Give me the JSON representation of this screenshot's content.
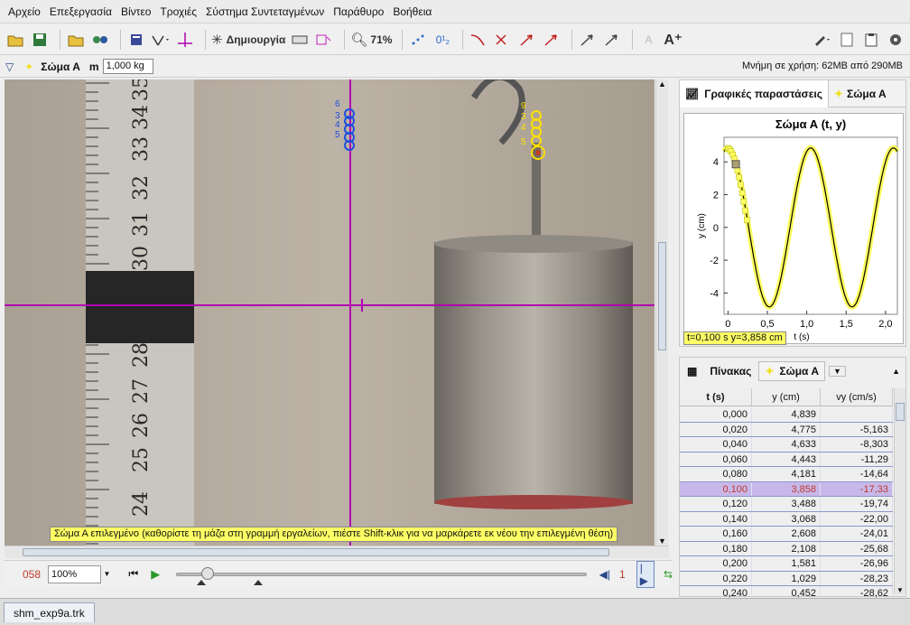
{
  "menu": [
    "Αρχείο",
    "Επεξεργασία",
    "Βίντεο",
    "Τροχιές",
    "Σύστημα Συντεταγμένων",
    "Παράθυρο",
    "Βοήθεια"
  ],
  "toolbar": {
    "create_label": "Δημιουργία",
    "zoom_value": "71%"
  },
  "massbar": {
    "object_name": "Σώμα Α",
    "mass_label": "m",
    "mass_value": "1,000 kg",
    "memory_text": "Μνήμη σε χρήση: 62MB από 290MB"
  },
  "video": {
    "status_message": "Σώμα Α επιλεγμένο (καθορίστε τη μάζα στη γραμμή εργαλείων, πιέστε Shift-κλικ για να μαρκάρετε εκ νέου την επιλεγμένη θέση)",
    "ruler_numbers": [
      "35",
      "34",
      "33",
      "32",
      "31",
      "30",
      "28",
      "27",
      "26",
      "25",
      "24"
    ],
    "blue_marker_labels": [
      "6",
      "3",
      "4",
      "5"
    ],
    "yellow_marker_labels": [
      "9",
      "3",
      "4",
      "5"
    ]
  },
  "player": {
    "frame": "058",
    "zoom": "100%",
    "step": "1"
  },
  "plot": {
    "tabs": [
      "Γραφικές παραστάσεις",
      "Σώμα Α"
    ],
    "readout": "t=0,100 s  y=3,858 cm"
  },
  "chart_data": {
    "type": "scatter",
    "title": "Σώμα Α (t, y)",
    "xlabel": "t (s)",
    "ylabel": "y (cm)",
    "xlim": [
      -0.05,
      2.15
    ],
    "ylim": [
      -5.3,
      5.5
    ],
    "xticks": [
      "0",
      "0,5",
      "1,0",
      "1,5",
      "2,0"
    ],
    "yticks": [
      "4",
      "2",
      "0",
      "-2",
      "-4"
    ],
    "x": [
      0.0,
      0.02,
      0.04,
      0.06,
      0.08,
      0.1,
      0.12,
      0.14,
      0.16,
      0.18,
      0.2,
      0.22,
      0.24
    ],
    "y": [
      4.839,
      4.775,
      4.633,
      4.443,
      4.181,
      3.858,
      3.488,
      3.068,
      2.608,
      2.108,
      1.581,
      1.029,
      0.452
    ],
    "fit_amplitude": 4.85,
    "fit_period": 1.05
  },
  "table": {
    "title": "Πίνακας",
    "object": "Σώμα Α",
    "headers": [
      "t (s)",
      "y (cm)",
      "vy (cm/s)"
    ],
    "rows": [
      [
        "0,000",
        "4,839",
        ""
      ],
      [
        "0,020",
        "4,775",
        "-5,163"
      ],
      [
        "0,040",
        "4,633",
        "-8,303"
      ],
      [
        "0,060",
        "4,443",
        "-11,29"
      ],
      [
        "0,080",
        "4,181",
        "-14,64"
      ],
      [
        "0,100",
        "3,858",
        "-17,33"
      ],
      [
        "0,120",
        "3,488",
        "-19,74"
      ],
      [
        "0,140",
        "3,068",
        "-22,00"
      ],
      [
        "0,160",
        "2,608",
        "-24,01"
      ],
      [
        "0,180",
        "2,108",
        "-25,68"
      ],
      [
        "0,200",
        "1,581",
        "-26,96"
      ],
      [
        "0,220",
        "1,029",
        "-28,23"
      ],
      [
        "0,240",
        "0,452",
        "-28,62"
      ]
    ],
    "highlight_row": 5
  },
  "statusbar": {
    "file": "shm_exp9a.trk"
  },
  "colors": {
    "axis": "#b000b0",
    "blue_marker": "#1a4fe0",
    "yellow_marker": "#ffe000",
    "highlight": "#c8b8ea"
  }
}
